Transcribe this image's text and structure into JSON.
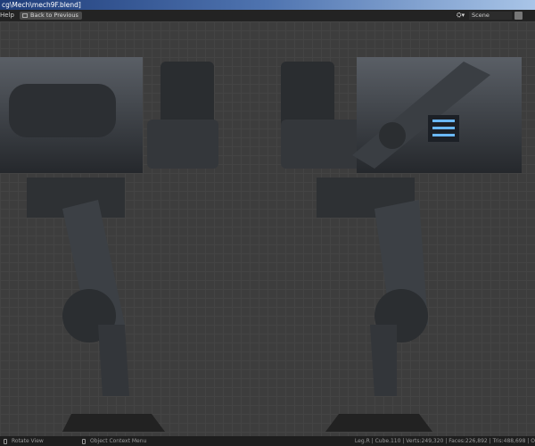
{
  "window": {
    "title": "cg\\Mech\\mech9F.blend]"
  },
  "header": {
    "menu_help": "Help",
    "back_button": "Back to Previous",
    "scene_label": "Scene"
  },
  "status": {
    "left_hint": "Rotate View",
    "mid_hint": "Object Context Menu",
    "stats": "Leg.R | Cube.110 | Verts:249,320 | Faces:226,892 | Tris:488,698 | O"
  }
}
